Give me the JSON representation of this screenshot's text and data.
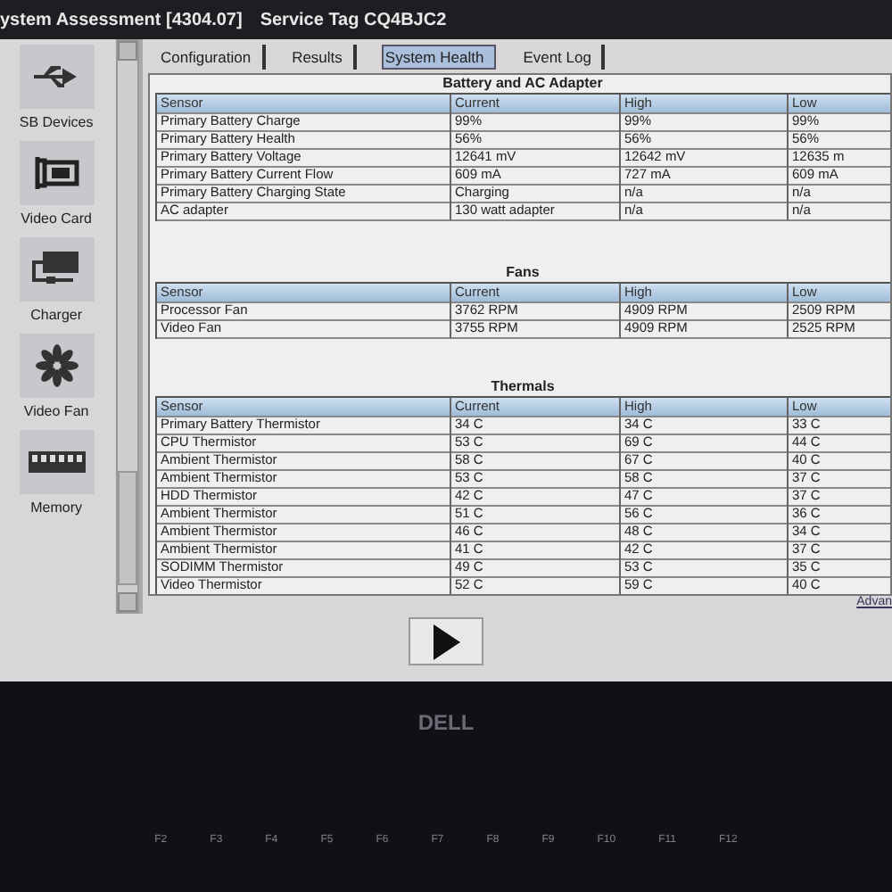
{
  "window": {
    "title": "ystem Assessment [4304.07]",
    "service_tag": "Service Tag CQ4BJC2"
  },
  "sidebar": {
    "items": [
      {
        "label": "SB Devices",
        "kind": "usb"
      },
      {
        "label": "Video Card",
        "kind": "card"
      },
      {
        "label": "Charger",
        "kind": "charger"
      },
      {
        "label": "Video Fan",
        "kind": "fan"
      },
      {
        "label": "Memory",
        "kind": "memory"
      }
    ]
  },
  "tabs": [
    {
      "label": "Configuration",
      "selected": false
    },
    {
      "label": "Results",
      "selected": false
    },
    {
      "label": "System Health",
      "selected": true
    },
    {
      "label": "Event Log",
      "selected": false
    }
  ],
  "sections": [
    {
      "title": "Battery and AC Adapter",
      "columns": [
        "Sensor",
        "Current",
        "High",
        "Low"
      ],
      "rows": [
        [
          "Primary Battery Charge",
          "99%",
          "99%",
          "99%"
        ],
        [
          "Primary Battery Health",
          "56%",
          "56%",
          "56%"
        ],
        [
          "Primary Battery Voltage",
          "12641 mV",
          "12642 mV",
          "12635 m"
        ],
        [
          "Primary Battery Current Flow",
          "609 mA",
          "727 mA",
          "609 mA"
        ],
        [
          "Primary Battery Charging State",
          "Charging",
          "n/a",
          "n/a"
        ],
        [
          "AC adapter",
          "130 watt adapter",
          "n/a",
          "n/a"
        ]
      ]
    },
    {
      "title": "Fans",
      "columns": [
        "Sensor",
        "Current",
        "High",
        "Low"
      ],
      "rows": [
        [
          "Processor Fan",
          "3762 RPM",
          "4909 RPM",
          "2509 RPM"
        ],
        [
          "Video Fan",
          "3755 RPM",
          "4909 RPM",
          "2525 RPM"
        ]
      ]
    },
    {
      "title": "Thermals",
      "columns": [
        "Sensor",
        "Current",
        "High",
        "Low"
      ],
      "rows": [
        [
          "Primary Battery Thermistor",
          "34 C",
          "34 C",
          "33 C"
        ],
        [
          "CPU Thermistor",
          "53 C",
          "69 C",
          "44 C"
        ],
        [
          "Ambient Thermistor",
          "58 C",
          "67 C",
          "40 C"
        ],
        [
          "Ambient Thermistor",
          "53 C",
          "58 C",
          "37 C"
        ],
        [
          "HDD Thermistor",
          "42 C",
          "47 C",
          "37 C"
        ],
        [
          "Ambient Thermistor",
          "51 C",
          "56 C",
          "36 C"
        ],
        [
          "Ambient Thermistor",
          "46 C",
          "48 C",
          "34 C"
        ],
        [
          "Ambient Thermistor",
          "41 C",
          "42 C",
          "37 C"
        ],
        [
          "SODIMM Thermistor",
          "49 C",
          "53 C",
          "35 C"
        ],
        [
          "Video Thermistor",
          "52 C",
          "59 C",
          "40 C"
        ]
      ]
    }
  ],
  "advanced_link": "Advan",
  "bezel": {
    "logo": "DELL",
    "keys": [
      "F2",
      "F3",
      "F4",
      "F5",
      "F6",
      "F7",
      "F8",
      "F9",
      "F10",
      "F11",
      "F12"
    ]
  }
}
